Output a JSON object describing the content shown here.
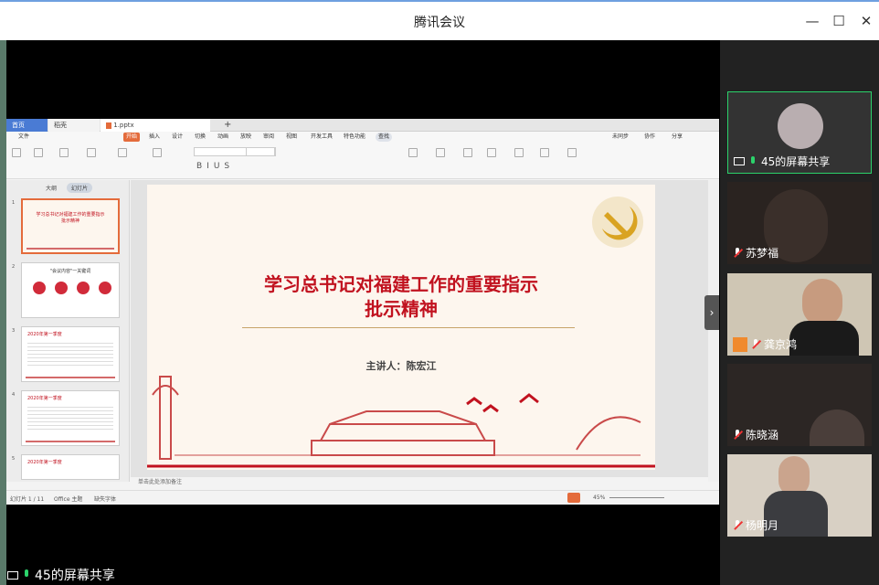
{
  "window": {
    "title": "腾讯会议"
  },
  "wps": {
    "tabs": {
      "home": "首页",
      "t2": "稻壳",
      "t3": "1.pptx"
    },
    "menu": [
      "文件",
      "开始",
      "插入",
      "设计",
      "切换",
      "动画",
      "放映",
      "审阅",
      "视图",
      "开发工具",
      "特色功能",
      "查找"
    ],
    "menu_right": [
      "未同步",
      "协作",
      "分享"
    ],
    "thumb_tabs": [
      "大纲",
      "幻灯片"
    ],
    "thumb_slides": [
      {
        "num": "1",
        "title": "学习总书记对福建工作的重要指示批示精神"
      },
      {
        "num": "2",
        "title": "\"会议内容\"一关键词"
      },
      {
        "num": "3",
        "title": "2020年第一季度"
      },
      {
        "num": "4",
        "title": "2020年第一季度"
      },
      {
        "num": "5",
        "title": "2020年第一季度"
      }
    ],
    "slide": {
      "title_line1": "学习总书记对福建工作的重要指示",
      "title_line2": "批示精神",
      "speaker": "主讲人：陈宏江"
    },
    "notes_placeholder": "单击此处添加备注",
    "status": {
      "slide_count": "幻灯片 1 / 11",
      "theme": "Office 主题",
      "missing_fonts": "缺失字体",
      "zoom": "45%"
    }
  },
  "participants": [
    {
      "name": "45的屏幕共享",
      "active": true
    },
    {
      "name": "苏梦福",
      "active": false
    },
    {
      "name": "龚京鸿",
      "active": false
    },
    {
      "name": "陈晓涵",
      "active": false
    },
    {
      "name": "杨明月",
      "active": false
    }
  ],
  "bottom": {
    "sharing_label": "45的屏幕共享"
  },
  "colors": {
    "accent_red": "#c1121f",
    "wps_orange": "#e46b3b",
    "active_green": "#2bd36b"
  }
}
